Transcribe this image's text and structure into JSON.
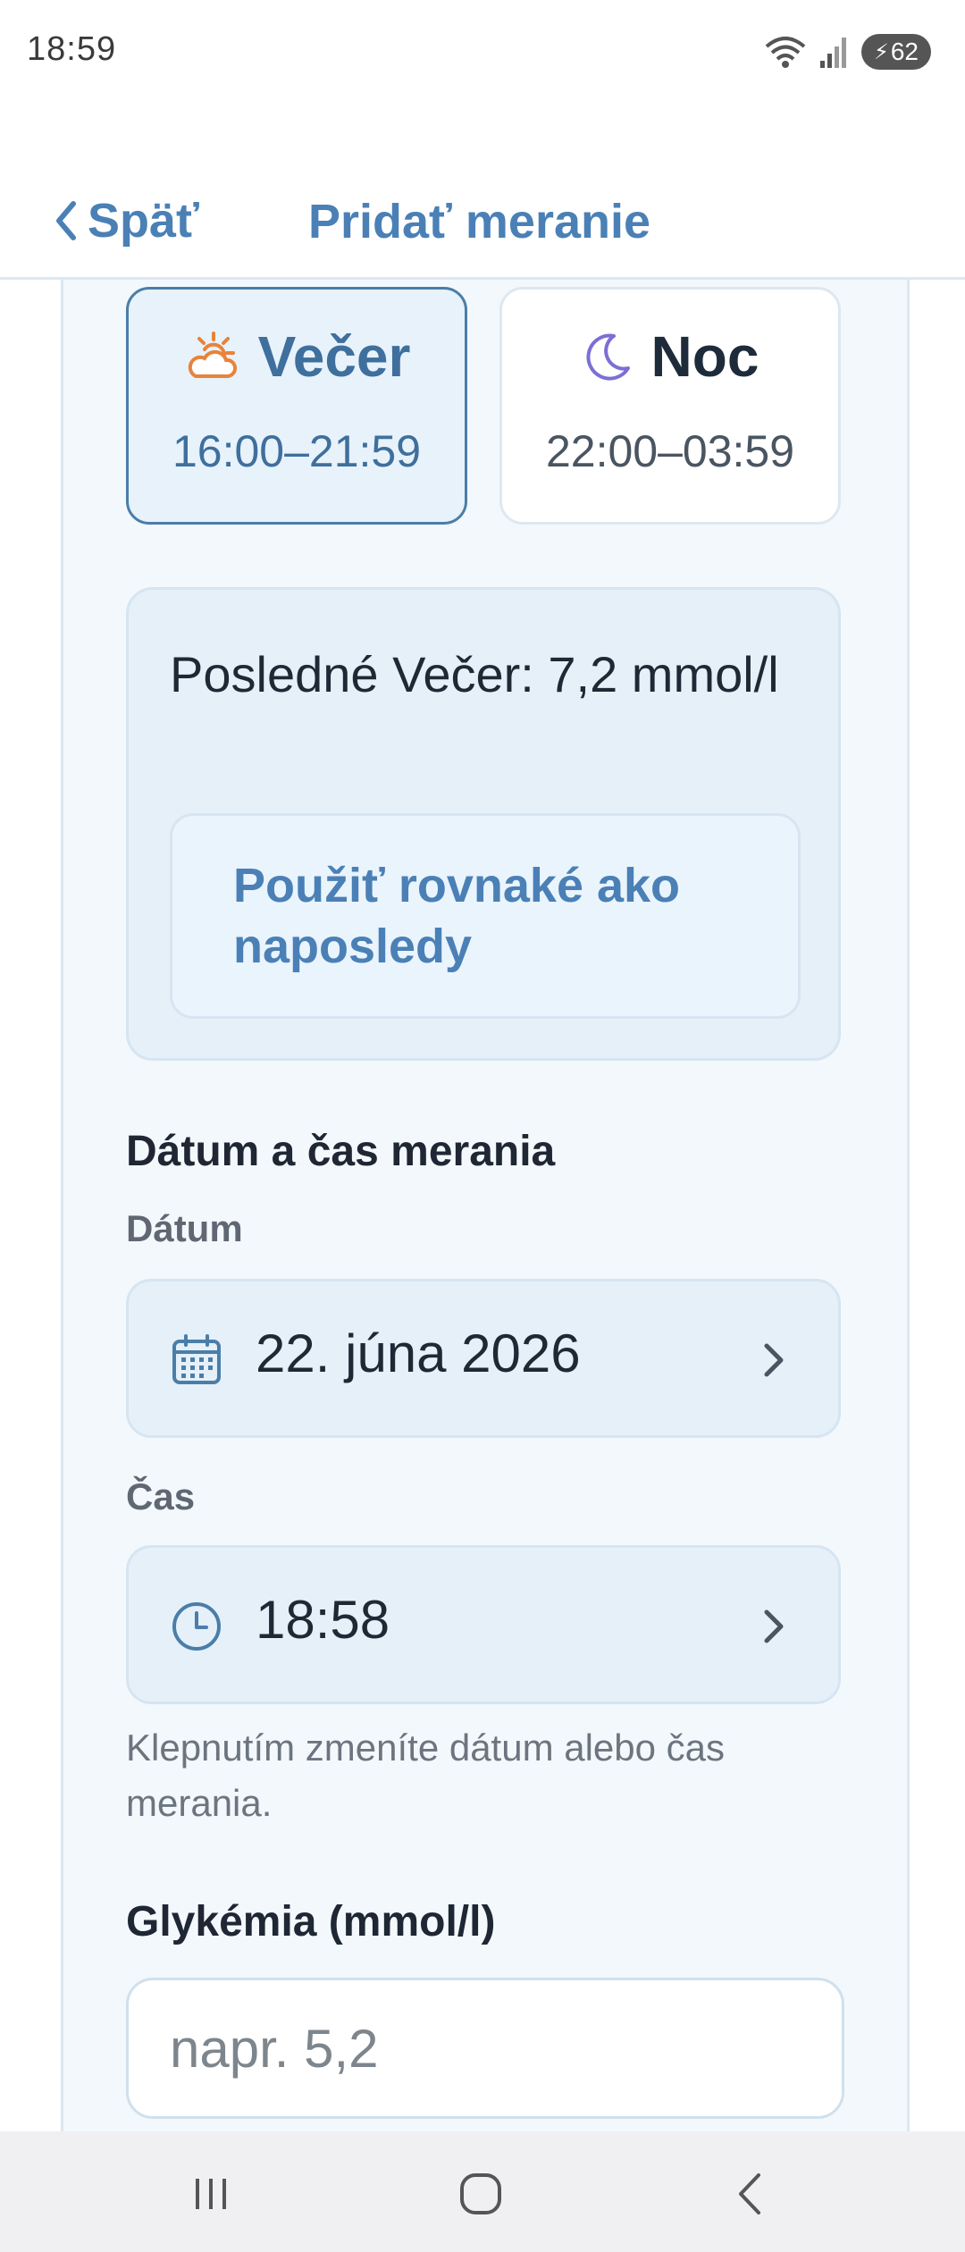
{
  "status_bar": {
    "time": "18:59",
    "battery_level": "62",
    "icons": [
      "wifi-icon",
      "signal-icon",
      "battery-charging-icon"
    ]
  },
  "header": {
    "back_label": "Späť",
    "title": "Pridať meranie"
  },
  "periods": {
    "evening": {
      "name": "Večer",
      "range": "16:00–21:59",
      "icon": "partly-cloudy-sun-icon",
      "selected": true
    },
    "night": {
      "name": "Noc",
      "range": "22:00–03:59",
      "icon": "moon-icon",
      "selected": false
    }
  },
  "last_measurement": {
    "text": "Posledné Večer: 7,2 mmol/l",
    "use_same_label": "Použiť rovnaké ako naposledy"
  },
  "datetime_section": {
    "title": "Dátum a čas merania",
    "date_label": "Dátum",
    "date_value": "22. júna 2026",
    "time_label": "Čas",
    "time_value": "18:58",
    "hint": "Klepnutím zmeníte dátum alebo čas merania."
  },
  "glycemia": {
    "label": "Glykémia (mmol/l)",
    "placeholder": "napr. 5,2",
    "value": ""
  },
  "colors": {
    "accent": "#4a80b6",
    "selected_border": "#4a7ea9",
    "panel_background": "#f3f8fc",
    "card_background": "#e5f0f9",
    "sun_icon": "#e8833a",
    "moon_icon": "#7b6fd6"
  }
}
